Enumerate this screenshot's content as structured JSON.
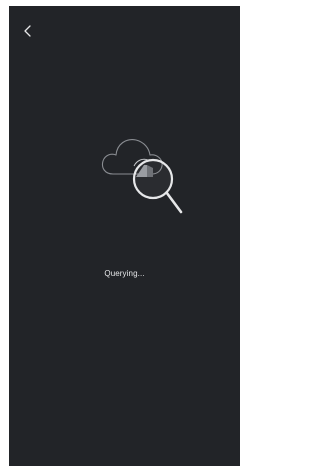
{
  "header": {
    "back_icon": "chevron-left-icon"
  },
  "illustration": {
    "cloud_icon": "cloud-outline-icon",
    "magnifier_icon": "magnifying-glass-icon"
  },
  "status": {
    "text": "Querying..."
  },
  "colors": {
    "background": "#222428",
    "foreground": "#e6e7e9",
    "cloud_stroke": "#8a8d92"
  }
}
